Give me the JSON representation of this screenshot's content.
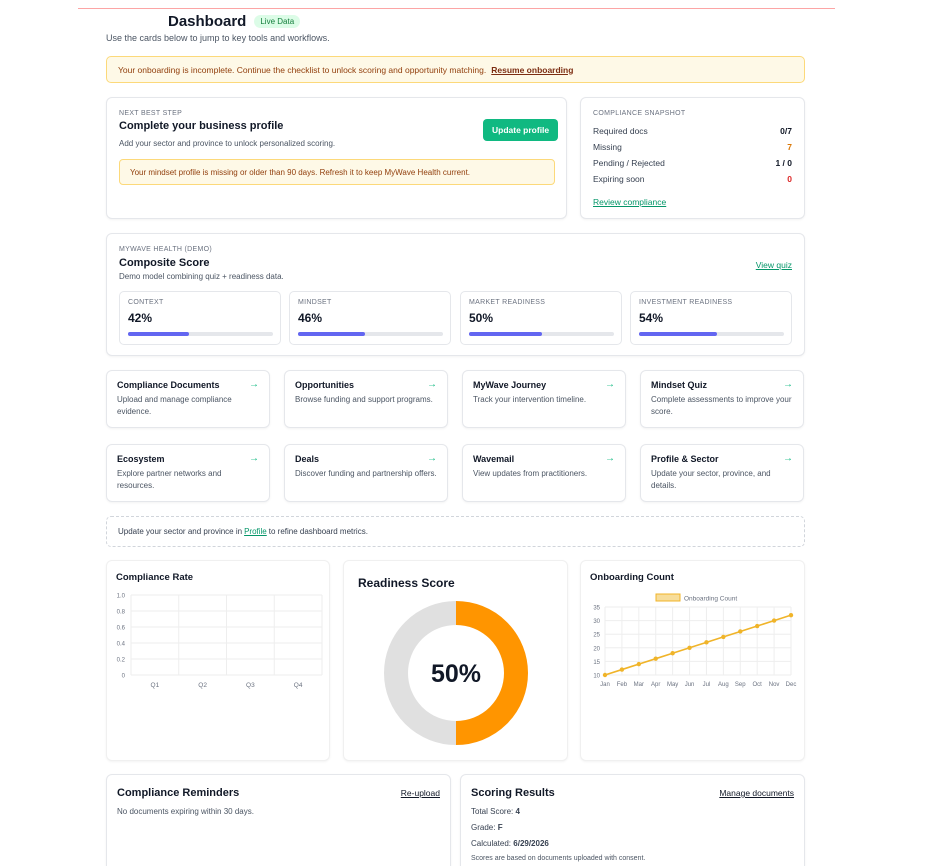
{
  "header": {
    "title": "Dashboard",
    "badge": "Live Data",
    "subtitle": "Use the cards below to jump to key tools and workflows."
  },
  "onboarding_alert": {
    "text": "Your onboarding is incomplete. Continue the checklist to unlock scoring and opportunity matching.",
    "link": "Resume onboarding"
  },
  "next_step": {
    "kicker": "NEXT BEST STEP",
    "title": "Complete your business profile",
    "desc": "Add your sector and province to unlock personalized scoring.",
    "button": "Update profile",
    "warning": "Your mindset profile is missing or older than 90 days. Refresh it to keep MyWave Health current."
  },
  "compliance_snapshot": {
    "kicker": "COMPLIANCE SNAPSHOT",
    "rows": [
      {
        "label": "Required docs",
        "value": "0/7",
        "color": "#111827"
      },
      {
        "label": "Missing",
        "value": "7",
        "color": "#d97706"
      },
      {
        "label": "Pending / Rejected",
        "value": "1 / 0",
        "color": "#111827"
      },
      {
        "label": "Expiring soon",
        "value": "0",
        "color": "#dc2626"
      }
    ],
    "link": "Review compliance"
  },
  "health": {
    "kicker": "MYWAVE HEALTH (DEMO)",
    "title": "Composite Score",
    "desc": "Demo model combining quiz + readiness data.",
    "link": "View quiz",
    "metrics": [
      {
        "label": "CONTEXT",
        "value": "42%",
        "pct": 42
      },
      {
        "label": "MINDSET",
        "value": "46%",
        "pct": 46
      },
      {
        "label": "MARKET READINESS",
        "value": "50%",
        "pct": 50
      },
      {
        "label": "INVESTMENT READINESS",
        "value": "54%",
        "pct": 54
      }
    ]
  },
  "tiles": [
    {
      "title": "Compliance Documents",
      "desc": "Upload and manage compliance evidence.",
      "arrow": "→"
    },
    {
      "title": "Opportunities",
      "desc": "Browse funding and support programs.",
      "arrow": "→"
    },
    {
      "title": "MyWave Journey",
      "desc": "Track your intervention timeline.",
      "arrow": "→"
    },
    {
      "title": "Mindset Quiz",
      "desc": "Complete assessments to improve your score.",
      "arrow": "→"
    },
    {
      "title": "Ecosystem",
      "desc": "Explore partner networks and resources.",
      "arrow": "→"
    },
    {
      "title": "Deals",
      "desc": "Discover funding and partnership offers.",
      "arrow": "→"
    },
    {
      "title": "Wavemail",
      "desc": "View updates from practitioners.",
      "arrow": "→"
    },
    {
      "title": "Profile & Sector",
      "desc": "Update your sector, province, and details.",
      "arrow": "→"
    }
  ],
  "profile_hint": {
    "before": "Update your sector and province in",
    "link": "Profile",
    "after": "to refine dashboard metrics."
  },
  "chart_data": [
    {
      "type": "bar",
      "title": "Compliance Rate",
      "categories": [
        "Q1",
        "Q2",
        "Q3",
        "Q4"
      ],
      "values": [
        0,
        0,
        0,
        0
      ],
      "ylim": [
        0,
        1.0
      ],
      "yticks": [
        "1.0",
        "0.8",
        "0.6",
        "0.4",
        "0.2",
        "0"
      ],
      "grid": true
    },
    {
      "type": "pie",
      "title": "Readiness Score",
      "center_label": "50%",
      "slices": [
        {
          "value": 50,
          "color": "#ff9500"
        },
        {
          "value": 50,
          "color": "#e0e0e0"
        }
      ]
    },
    {
      "type": "line",
      "title": "Onboarding Count",
      "legend": "Onboarding Count",
      "legend_position": "top",
      "categories": [
        "Jan",
        "Feb",
        "Mar",
        "Apr",
        "May",
        "Jun",
        "Jul",
        "Aug",
        "Sep",
        "Oct",
        "Nov",
        "Dec"
      ],
      "values": [
        10,
        12,
        14,
        16,
        18,
        20,
        22,
        24,
        26,
        28,
        30,
        32
      ],
      "ylim": [
        10,
        35
      ],
      "yticks": [
        "35",
        "30",
        "25",
        "20",
        "15",
        "10"
      ],
      "color": "#f0b429",
      "grid": true
    }
  ],
  "reminders": {
    "title": "Compliance Reminders",
    "link": "Re-upload",
    "text": "No documents expiring within 30 days."
  },
  "scoring": {
    "title": "Scoring Results",
    "link": "Manage documents",
    "total_label": "Total Score:",
    "total_value": "4",
    "grade_label": "Grade:",
    "grade_value": "F",
    "calc_label": "Calculated:",
    "calc_value": "6/29/2026",
    "note": "Scores are based on documents uploaded with consent."
  }
}
